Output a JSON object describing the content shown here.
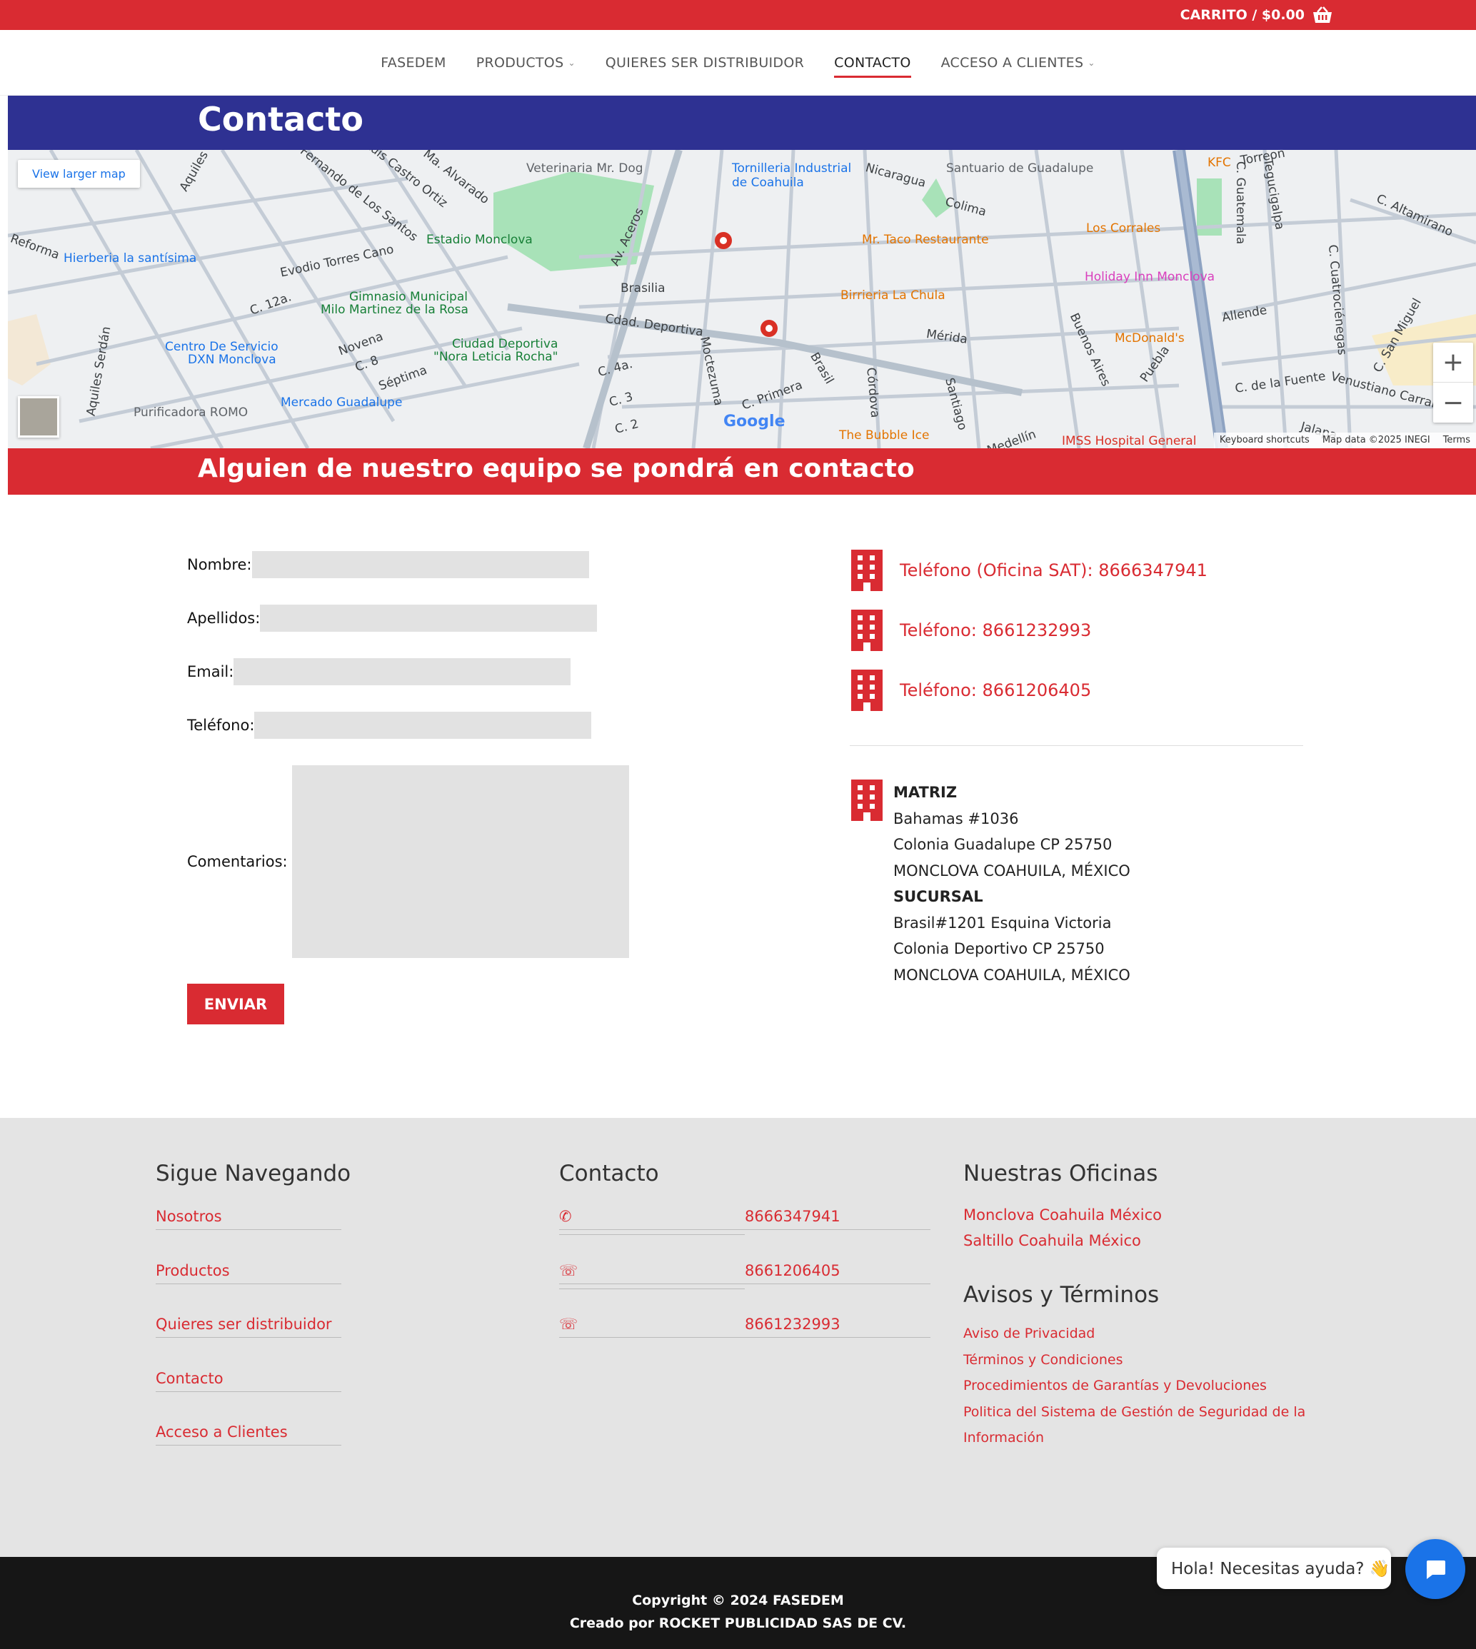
{
  "topbar": {
    "cart_label": "CARRITO / $0.00"
  },
  "nav": {
    "items": [
      {
        "label": "FASEDEM"
      },
      {
        "label": "PRODUCTOS"
      },
      {
        "label": "QUIERES SER DISTRIBUIDOR"
      },
      {
        "label": "CONTACTO"
      },
      {
        "label": "ACCESO A CLIENTES"
      }
    ]
  },
  "page_title": "Contacto",
  "map": {
    "view_larger": "View larger map",
    "attribution": {
      "shortcuts": "Keyboard shortcuts",
      "data": "Map data ©2025 INEGI",
      "terms": "Terms"
    },
    "google": "Google",
    "places": [
      "Veterinaria Mr. Dog",
      "Tornilleria Industrial",
      "de Coahuila",
      "Santuario de Guadalupe",
      "KFC",
      "Estadio Monclova",
      "Mr. Taco Restaurante",
      "Los Corrales",
      "Hierberia la santísima",
      "Holiday Inn Monclova",
      "Gimnasio Municipal",
      "Milo Martinez de la Rosa",
      "Birrieria La Chula",
      "McDonald's",
      "Centro De Servicio",
      "DXN Monclova",
      "Ciudad Deportiva",
      "\"Nora Leticia Rocha\"",
      "Mercado Guadalupe",
      "Purificadora ROMO",
      "The Bubble Ice",
      "IMSS Hospital General"
    ],
    "streets": [
      "Aquiles",
      "Fernando de Los Santos",
      "Ma. Alvarado",
      "Luis Castro Ortiz",
      "Nicaragua",
      "Colima",
      "Torreon",
      "C. Guatemala",
      "Tegucigalpa",
      "C. Altamirano",
      "Reforma",
      "Evodio Torres Cano",
      "Av. Aceros",
      "Brasilia",
      "C. 12a.",
      "Allende",
      "Cdad. Deportiva",
      "Mérida",
      "Novena",
      "C. 8",
      "Séptima",
      "C. 4a.",
      "C. 3",
      "C. 2",
      "Moctezuma",
      "C. Primera",
      "Brasil",
      "Córdova",
      "Santiago",
      "Buenos Aires",
      "Puebla",
      "C. de la Fuente",
      "Venustiano Carranza",
      "C. San Miguel",
      "C. Cuatrociénegas",
      "Aquiles Serdán",
      "Medellín",
      "Jalapa"
    ]
  },
  "contact_banner": "Alguien de nuestro equipo se pondrá en contacto",
  "form": {
    "nombre_label": "Nombre:",
    "apellidos_label": "Apellidos:",
    "email_label": "Email:",
    "telefono_label": "Teléfono:",
    "comentarios_label": "Comentarios:",
    "submit_label": "ENVIAR"
  },
  "phones": [
    {
      "label": "Teléfono (Oficina SAT): 8666347941"
    },
    {
      "label": "Teléfono: 8661232993"
    },
    {
      "label": "Teléfono: 8661206405"
    }
  ],
  "address": {
    "matriz_title": "MATRIZ",
    "matriz_line1": "Bahamas #1036",
    "matriz_line2": "Colonia Guadalupe CP 25750",
    "matriz_line3": "MONCLOVA COAHUILA, MÉXICO",
    "sucursal_title": "SUCURSAL",
    "sucursal_line1": "Brasil#1201 Esquina Victoria",
    "sucursal_line2": "Colonia Deportivo CP 25750",
    "sucursal_line3": "MONCLOVA COAHUILA, MÉXICO"
  },
  "footer": {
    "nav_title": "Sigue Navegando",
    "nav_links": [
      "Nosotros",
      "Productos",
      "Quieres ser distribuidor",
      "Contacto",
      "Acceso a Clientes"
    ],
    "contact_title": "Contacto",
    "contact_links": [
      "8666347941",
      "8661206405",
      "8661232993"
    ],
    "offices_title": "Nuestras Oficinas",
    "offices": [
      "Monclova Coahuila México",
      "Saltillo Coahuila México"
    ],
    "legal_title": "Avisos y Términos",
    "legal_links": [
      "Aviso de Privacidad",
      "Términos y Condiciones",
      "Procedimientos de Garantías y Devoluciones",
      "Politica del Sistema de Gestión de Seguridad de la",
      "Información"
    ]
  },
  "bottom": {
    "copyright": "Copyright © 2024 FASEDEM",
    "credit": "Creado por ROCKET PUBLICIDAD SAS DE CV."
  },
  "chat": {
    "bubble": "Hola! Necesitas ayuda? 👋"
  },
  "colors": {
    "brand_red": "#d92b32",
    "brand_blue": "#2e3192",
    "footer_bg": "#e4e4e4",
    "bottom_bg": "#161616",
    "chat_blue": "#1a73e8"
  }
}
